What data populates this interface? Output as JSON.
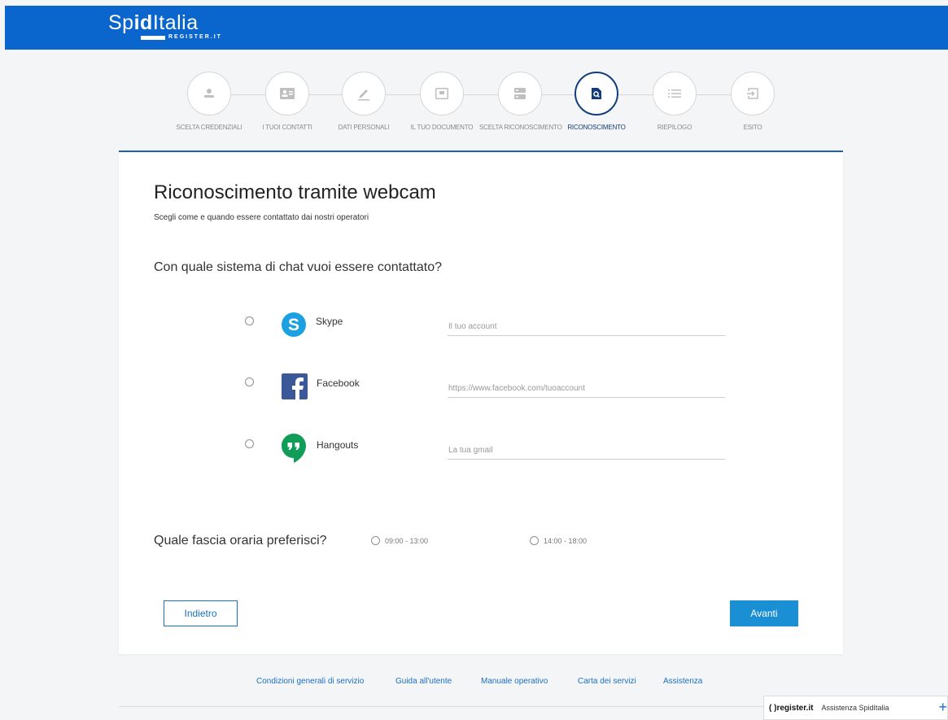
{
  "header": {
    "logo_part1": "Sp",
    "logo_part2": "id",
    "logo_part3": "Italia",
    "logo_sub": "REGISTER.IT",
    "bg_color": "#0a66cc"
  },
  "steps": [
    {
      "label": "SCELTA CREDENZIALI",
      "icon": "user-icon",
      "active": false
    },
    {
      "label": "I TUOI CONTATTI",
      "icon": "contact-card-icon",
      "active": false
    },
    {
      "label": "DATI PERSONALI",
      "icon": "pencil-icon",
      "active": false
    },
    {
      "label": "IL TUO DOCUMENTO",
      "icon": "document-icon",
      "active": false
    },
    {
      "label": "SCELTA RICONOSCIMENTO",
      "icon": "server-icon",
      "active": false
    },
    {
      "label": "RICONOSCIMENTO",
      "icon": "search-document-icon",
      "active": true
    },
    {
      "label": "RIEPILOGO",
      "icon": "list-icon",
      "active": false
    },
    {
      "label": "ESITO",
      "icon": "exit-icon",
      "active": false
    }
  ],
  "main": {
    "title": "Riconoscimento tramite webcam",
    "subtitle": "Scegli come e quando essere contattato dai nostri operatori",
    "question_chat": "Con quale sistema di chat vuoi essere contattato?",
    "chat_options": [
      {
        "label": "Skype",
        "placeholder": "Il tuo account",
        "icon": "skype-icon",
        "color": "#1ba0e1"
      },
      {
        "label": "Facebook",
        "placeholder": "https://www.facebook.com/tuoaccount",
        "icon": "facebook-icon",
        "color": "#3b5998"
      },
      {
        "label": "Hangouts",
        "placeholder": "La tua gmail",
        "icon": "hangouts-icon",
        "color": "#0f9d58"
      }
    ],
    "question_time": "Quale fascia oraria preferisci?",
    "time_slots": [
      "09:00 - 13:00",
      "14:00 - 18:00"
    ],
    "back_label": "Indietro",
    "next_label": "Avanti"
  },
  "footer": {
    "links": [
      "Condizioni generali di servizio",
      "Guida all'utente",
      "Manuale operativo",
      "Carta dei servizi",
      "Assistenza"
    ]
  },
  "assist_widget": {
    "brand": "( )register.it",
    "label": "Assistenza SpidItalia",
    "plus": "+"
  }
}
